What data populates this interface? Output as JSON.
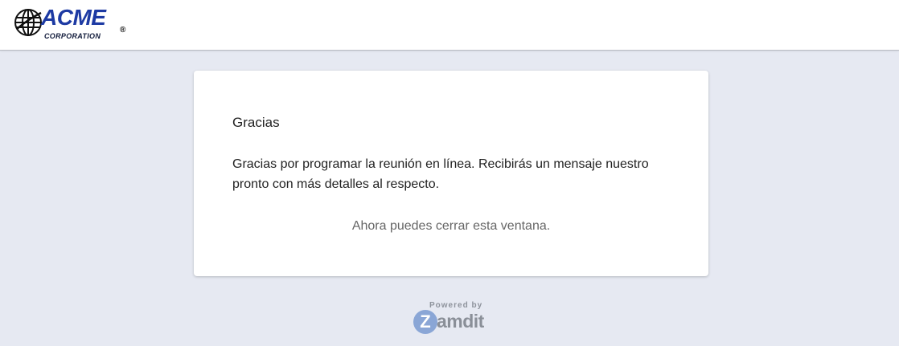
{
  "header": {
    "logo": {
      "brand": "ACME",
      "registered": "®",
      "subtitle": "CORPORATION",
      "icon": "globe-icon",
      "brand_color": "#1d3aa3"
    }
  },
  "card": {
    "title": "Gracias",
    "message": "Gracias por programar la reunión en línea. Recibirás un mensaje nuestro pronto con más detalles al respecto.",
    "note": "Ahora puedes cerrar esta ventana."
  },
  "footer": {
    "powered_by": "Powered by",
    "brand_letter": "Z",
    "brand_rest": "amdit",
    "accent_color": "#8aa6d6"
  },
  "colors": {
    "background": "#e6e9f2",
    "card": "#ffffff"
  }
}
